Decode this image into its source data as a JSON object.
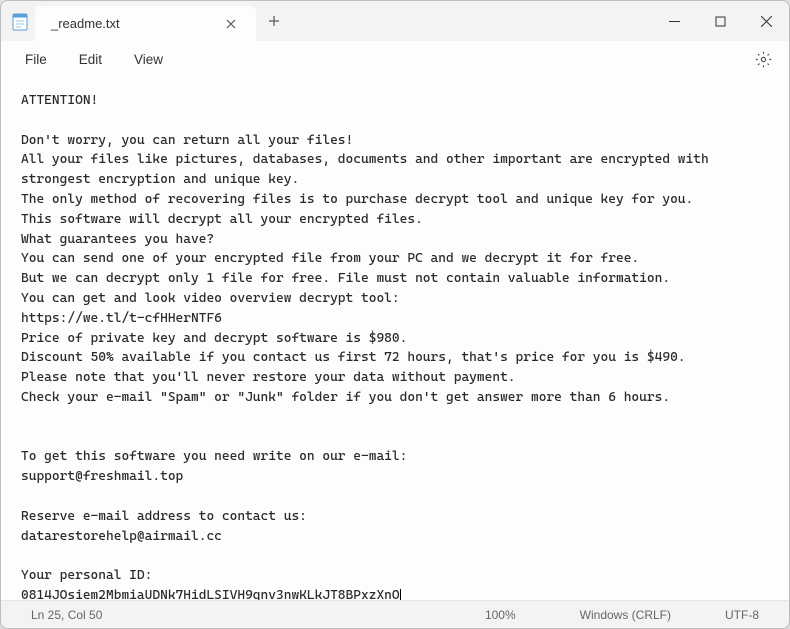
{
  "window": {
    "tab_title": "_readme.txt",
    "close_glyph": "✕"
  },
  "menu": {
    "file": "File",
    "edit": "Edit",
    "view": "View"
  },
  "body": {
    "lines": [
      "ATTENTION!",
      "",
      "Don't worry, you can return all your files!",
      "All your files like pictures, databases, documents and other important are encrypted with strongest encryption and unique key.",
      "The only method of recovering files is to purchase decrypt tool and unique key for you.",
      "This software will decrypt all your encrypted files.",
      "What guarantees you have?",
      "You can send one of your encrypted file from your PC and we decrypt it for free.",
      "But we can decrypt only 1 file for free. File must not contain valuable information.",
      "You can get and look video overview decrypt tool:",
      "https://we.tl/t-cfHHerNTF6",
      "Price of private key and decrypt software is $980.",
      "Discount 50% available if you contact us first 72 hours, that's price for you is $490.",
      "Please note that you'll never restore your data without payment.",
      "Check your e-mail \"Spam\" or \"Junk\" folder if you don't get answer more than 6 hours.",
      "",
      "",
      "To get this software you need write on our e-mail:",
      "support@freshmail.top",
      "",
      "Reserve e-mail address to contact us:",
      "datarestorehelp@airmail.cc",
      "",
      "Your personal ID:",
      "0814JOsiem2MbmiaUDNk7HidLSIVH9qnv3nwKLkJT8BPxzXnO"
    ]
  },
  "status": {
    "position": "Ln 25, Col 50",
    "zoom": "100%",
    "line_ending": "Windows (CRLF)",
    "encoding": "UTF-8"
  }
}
